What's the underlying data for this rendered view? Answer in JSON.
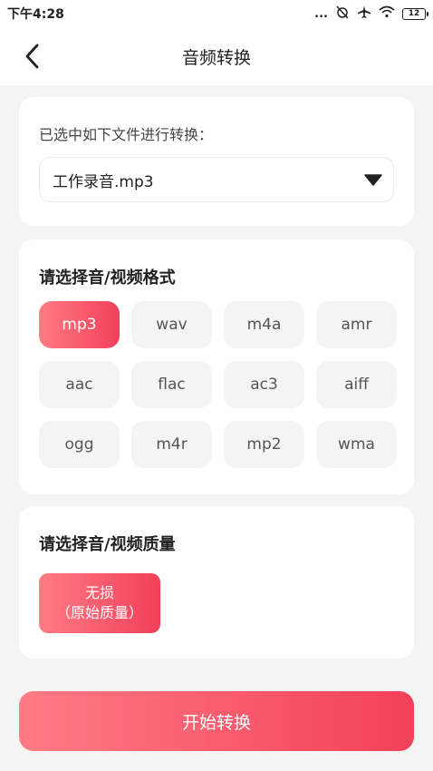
{
  "status_bar": {
    "time": "下午4:28",
    "dots": "...",
    "battery_level": "12"
  },
  "nav": {
    "title": "音频转换"
  },
  "file_section": {
    "label": "已选中如下文件进行转换：",
    "selected_file": "工作录音.mp3"
  },
  "format_section": {
    "title": "请选择音/视频格式",
    "selected": "mp3",
    "formats": [
      "mp3",
      "wav",
      "m4a",
      "amr",
      "aac",
      "flac",
      "ac3",
      "aiff",
      "ogg",
      "m4r",
      "mp2",
      "wma"
    ]
  },
  "quality_section": {
    "title": "请选择音/视频质量",
    "option_line1": "无损",
    "option_line2": "（原始质量）"
  },
  "start_button": {
    "label": "开始转换"
  },
  "colors": {
    "accent_start": "#ff7b85",
    "accent_end": "#f2405a",
    "background": "#f4f4f4"
  }
}
